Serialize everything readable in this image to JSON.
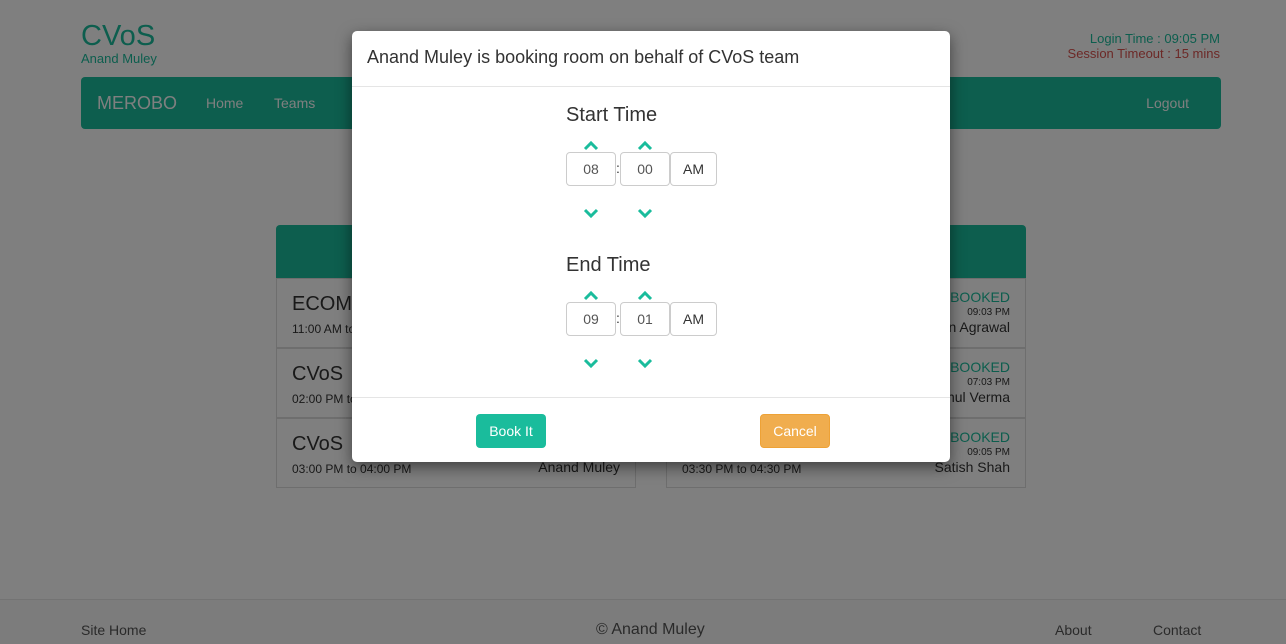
{
  "header": {
    "brand": "CVoS",
    "user": "Anand Muley",
    "login_time": "Login Time : 09:05 PM",
    "session_timeout": "Session Timeout : 15 mins"
  },
  "navbar": {
    "brand": "MEROBO",
    "home": "Home",
    "teams": "Teams",
    "logout": "Logout"
  },
  "bookings_left": [
    {
      "team": "ECOM",
      "time": "11:00 AM to",
      "person": ""
    },
    {
      "team": "CVoS",
      "time": "02:00 PM to",
      "person": ""
    },
    {
      "team": "CVoS",
      "time": "03:00 PM to 04:00 PM",
      "person": "Anand Muley"
    }
  ],
  "bookings_right": [
    {
      "status": "BOOKED",
      "booked_at": "09:03 PM",
      "person": "n Agrawal",
      "time": ""
    },
    {
      "status": "BOOKED",
      "booked_at": "07:03 PM",
      "person": "nul Verma",
      "time": ""
    },
    {
      "status": "BOOKED",
      "booked_at": "09:05 PM",
      "person": "Satish Shah",
      "time": "03:30 PM to 04:30 PM"
    }
  ],
  "modal": {
    "title": "Anand Muley is booking room on behalf of CVoS team",
    "start": {
      "label": "Start Time",
      "hour": "08",
      "minute": "00",
      "meridian": "AM"
    },
    "end": {
      "label": "End Time",
      "hour": "09",
      "minute": "01",
      "meridian": "AM"
    },
    "separator": ":",
    "book_label": "Book It",
    "cancel_label": "Cancel"
  },
  "footer": {
    "site_home": "Site Home",
    "copyright": "© Anand Muley",
    "about": "About",
    "contact": "Contact"
  },
  "colors": {
    "primary": "#1abc9c",
    "warning": "#f0ad4e",
    "danger": "#d9534f"
  },
  "icons": {
    "increment": "chevron-up-icon",
    "decrement": "chevron-down-icon"
  }
}
